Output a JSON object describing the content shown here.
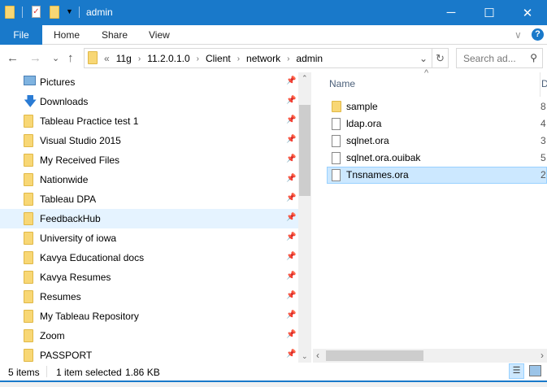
{
  "window": {
    "title": "admin",
    "minimize": "─",
    "maximize": "☐",
    "close": "✕"
  },
  "ribbon": {
    "file": "File",
    "tabs": [
      "Home",
      "Share",
      "View"
    ],
    "help": "?",
    "expand": "∨"
  },
  "nav": {
    "back": "←",
    "forward": "→",
    "recent": "⌄",
    "up": "↑"
  },
  "address": {
    "overflow": "«",
    "crumbs": [
      "11g",
      "11.2.0.1.0",
      "Client",
      "network",
      "admin"
    ],
    "dropdown": "⌄",
    "refresh": "↻"
  },
  "search": {
    "placeholder": "Search ad...",
    "icon": "⚲"
  },
  "sidebar": {
    "items": [
      {
        "label": "Pictures",
        "icon": "pictures-icon"
      },
      {
        "label": "Downloads",
        "icon": "downloads-icon"
      },
      {
        "label": "Tableau Practice test 1",
        "icon": "folder-icon"
      },
      {
        "label": "Visual Studio 2015",
        "icon": "folder-icon"
      },
      {
        "label": "My Received Files",
        "icon": "folder-icon"
      },
      {
        "label": "Nationwide",
        "icon": "folder-icon"
      },
      {
        "label": "Tableau DPA",
        "icon": "folder-icon"
      },
      {
        "label": "FeedbackHub",
        "icon": "folder-icon",
        "selected": true
      },
      {
        "label": "University of iowa",
        "icon": "folder-icon"
      },
      {
        "label": "Kavya Educational docs",
        "icon": "folder-icon"
      },
      {
        "label": "Kavya Resumes",
        "icon": "folder-icon"
      },
      {
        "label": "Resumes",
        "icon": "folder-icon"
      },
      {
        "label": "My Tableau Repository",
        "icon": "folder-icon"
      },
      {
        "label": "Zoom",
        "icon": "folder-icon"
      },
      {
        "label": "PASSPORT",
        "icon": "folder-icon"
      }
    ],
    "pin": "📌"
  },
  "files": {
    "columns": {
      "name": "Name",
      "date": "D"
    },
    "sort_indicator": "^",
    "items": [
      {
        "name": "sample",
        "type": "folder",
        "date": "8"
      },
      {
        "name": "ldap.ora",
        "type": "file",
        "date": "4"
      },
      {
        "name": "sqlnet.ora",
        "type": "file",
        "date": "3"
      },
      {
        "name": "sqlnet.ora.ouibak",
        "type": "file",
        "date": "5"
      },
      {
        "name": "Tnsnames.ora",
        "type": "file",
        "date": "2",
        "selected": true
      }
    ]
  },
  "status": {
    "count": "5 items",
    "selection": "1 item selected",
    "size": "1.86 KB"
  },
  "colors": {
    "accent": "#1979ca",
    "selection": "#cce8ff",
    "hover": "#e5f3ff"
  }
}
